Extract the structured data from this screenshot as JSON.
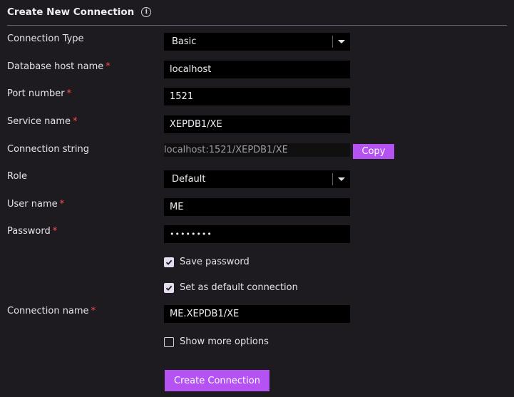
{
  "header": {
    "title": "Create New Connection",
    "info_icon": "info-icon"
  },
  "fields": {
    "connection_type": {
      "label": "Connection Type",
      "value": "Basic"
    },
    "db_host": {
      "label": "Database host name",
      "required": "*",
      "value": "localhost"
    },
    "port": {
      "label": "Port number",
      "required": "*",
      "value": "1521"
    },
    "service": {
      "label": "Service name",
      "required": "*",
      "value": "XEPDB1/XE"
    },
    "conn_string": {
      "label": "Connection string",
      "value": "localhost:1521/XEPDB1/XE",
      "copy_label": "Copy"
    },
    "role": {
      "label": "Role",
      "value": "Default"
    },
    "username": {
      "label": "User name",
      "required": "*",
      "value": "ME"
    },
    "password": {
      "label": "Password",
      "required": "*",
      "value": "••••••••"
    },
    "conn_name": {
      "label": "Connection name",
      "required": "*",
      "value": "ME.XEPDB1/XE"
    }
  },
  "checkboxes": {
    "save_password": {
      "label": "Save password",
      "checked": true
    },
    "default_connection": {
      "label": "Set as default connection",
      "checked": true
    },
    "more_options": {
      "label": "Show more options",
      "checked": false
    }
  },
  "actions": {
    "create_label": "Create Connection"
  },
  "colors": {
    "accent": "#b452f2",
    "background": "#1e1b20",
    "required": "#ff4d4d"
  }
}
